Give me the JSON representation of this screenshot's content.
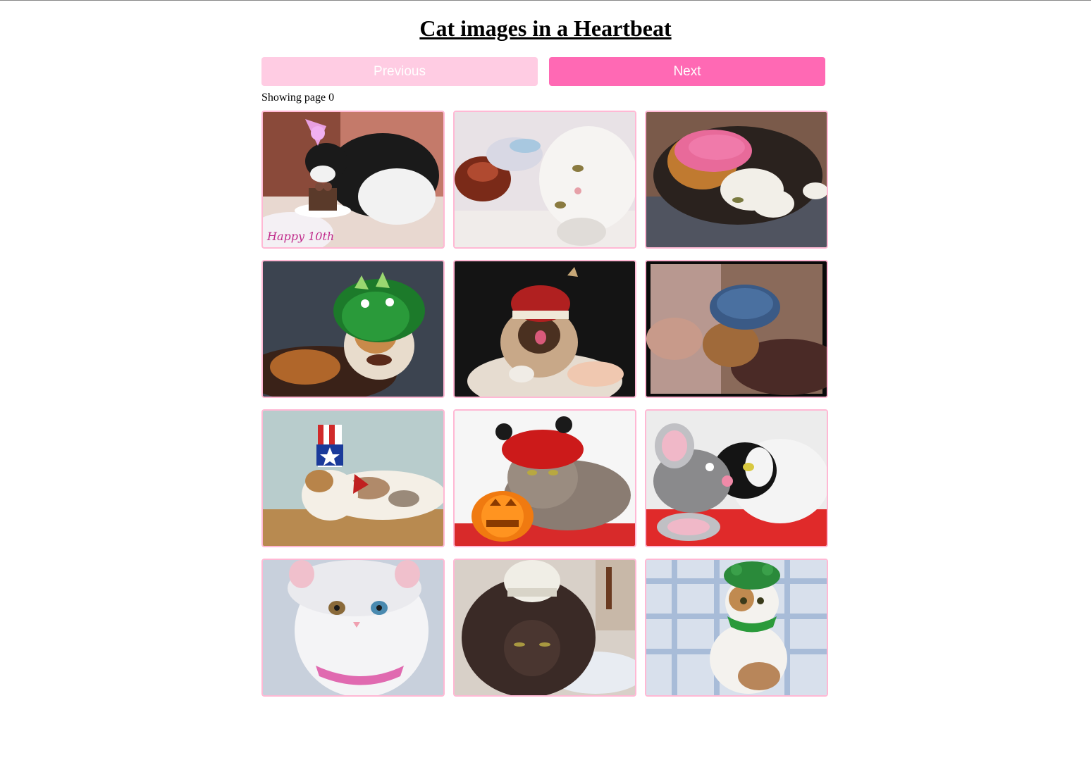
{
  "header": {
    "title": "Cat images in a Heartbeat"
  },
  "pagination": {
    "previous_label": "Previous",
    "next_label": "Next",
    "status_text": "Showing page 0",
    "current_page": 0,
    "previous_enabled": false
  },
  "colors": {
    "accent": "#ff69b4",
    "accent_disabled": "#ffcce3",
    "card_border": "#ffb8d4"
  },
  "gallery": {
    "images": [
      {
        "subject": "black and white cat with party hat eating birthday cake"
      },
      {
        "subject": "white cat lying next to knitted hat"
      },
      {
        "subject": "calico cat wearing pink knitted cap"
      },
      {
        "subject": "calico cat wearing green dinosaur hat"
      },
      {
        "subject": "siamese cat wearing red santa hat"
      },
      {
        "subject": "orange cat wearing blue knitted hat"
      },
      {
        "subject": "calico cat wearing uncle sam top hat"
      },
      {
        "subject": "tabby cat in red devil hat with jack-o-lantern"
      },
      {
        "subject": "black and white cat in grey mouse costume"
      },
      {
        "subject": "white cat with odd eyes in white bonnet"
      },
      {
        "subject": "dark brown cat wearing white knitted cap"
      },
      {
        "subject": "calico cat wearing green frog hat"
      }
    ]
  }
}
